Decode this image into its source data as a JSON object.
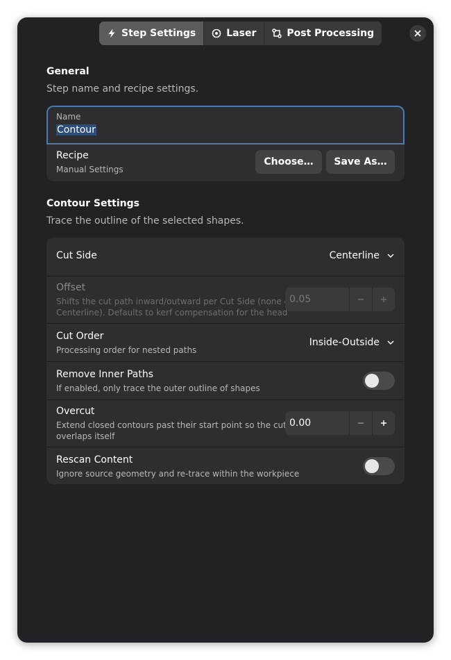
{
  "tabs": [
    {
      "label": "Step Settings",
      "icon": "lightning-icon",
      "active": true
    },
    {
      "label": "Laser",
      "icon": "target-icon",
      "active": false
    },
    {
      "label": "Post Processing",
      "icon": "flow-icon",
      "active": false
    }
  ],
  "close_icon": "close-icon",
  "general": {
    "title": "General",
    "subtitle": "Step name and recipe settings.",
    "name_label": "Name",
    "name_value": "Contour",
    "recipe_title": "Recipe",
    "recipe_value": "Manual Settings",
    "choose_label": "Choose…",
    "save_as_label": "Save As…"
  },
  "contour": {
    "title": "Contour Settings",
    "subtitle": "Trace the outline of the selected shapes.",
    "cut_side": {
      "title": "Cut Side",
      "value": "Centerline"
    },
    "offset": {
      "title": "Offset",
      "desc_line1": "Shifts the cut path inward/outward per Cut Side (none on",
      "desc_line2": "Centerline). Defaults to kerf compensation for the head",
      "value": "0.05"
    },
    "cut_order": {
      "title": "Cut Order",
      "desc": "Processing order for nested paths",
      "value": "Inside-Outside"
    },
    "remove_inner": {
      "title": "Remove Inner Paths",
      "desc": "If enabled, only trace the outer outline of shapes",
      "enabled": false
    },
    "overcut": {
      "title": "Overcut",
      "desc_line1": "Extend closed contours past their start point so the cut",
      "desc_line2": "overlaps itself",
      "value": "0.00"
    },
    "rescan": {
      "title": "Rescan Content",
      "desc": "Ignore source geometry and re-trace within the workpiece",
      "enabled": false
    }
  },
  "colors": {
    "background": "#222226",
    "card": "#2e2e32",
    "focus": "#4f7ab0",
    "selection": "#2d4e78"
  }
}
